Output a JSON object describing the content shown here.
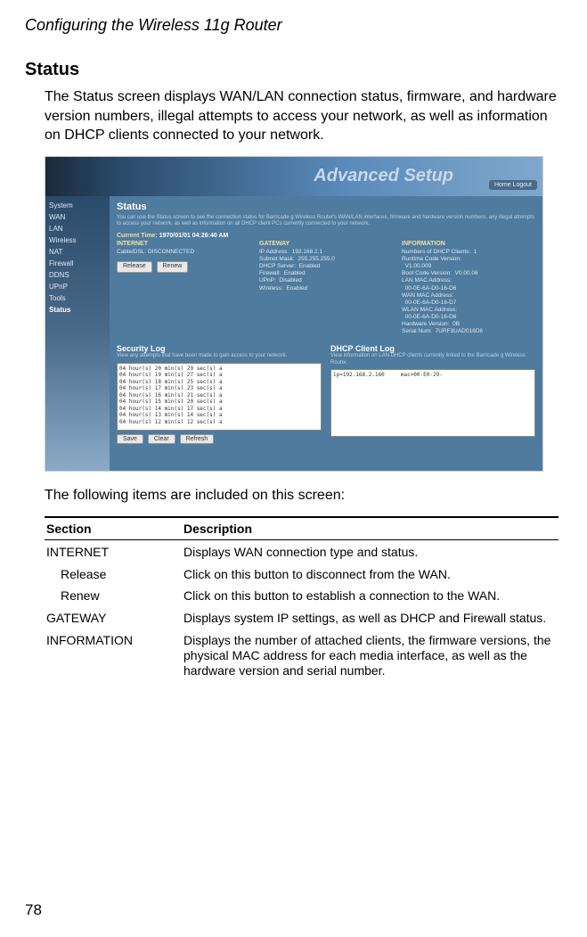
{
  "header": "Configuring the Wireless 11g Router",
  "section_title": "Status",
  "intro_para": "The Status screen displays WAN/LAN connection status, firmware, and hardware version numbers, illegal attempts to access your network, as well as information on DHCP clients connected to your network.",
  "following_text": "The following items are included on this screen:",
  "table": {
    "headers": [
      "Section",
      "Description"
    ],
    "rows": [
      {
        "section": "INTERNET",
        "indent": false,
        "desc": "Displays WAN connection type and status."
      },
      {
        "section": "Release",
        "indent": true,
        "desc": "Click on this button to disconnect from the WAN."
      },
      {
        "section": "Renew",
        "indent": true,
        "desc": "Click on this button to establish a connection to the WAN."
      },
      {
        "section": "GATEWAY",
        "indent": false,
        "desc": "Displays system IP settings, as well as DHCP and Firewall status."
      },
      {
        "section": "INFORMATION",
        "indent": false,
        "desc": "Displays the number of attached clients, the firmware versions, the physical MAC address for each media interface, as well as the hardware version and serial number."
      }
    ]
  },
  "page_number": "78",
  "screenshot": {
    "banner": "Advanced Setup",
    "home_logout": "Home  Logout",
    "sidebar": [
      "System",
      "WAN",
      "LAN",
      "Wireless",
      "NAT",
      "Firewall",
      "DDNS",
      "UPnP",
      "Tools",
      "Status"
    ],
    "title": "Status",
    "desc": "You can use the Status screen to see the connection status for Barricade g Wireless Router's WAN/LAN interfaces, firmware and hardware version numbers, any illegal attempts to access your network, as well as information on all DHCP client PCs currently connected to your network.",
    "current_time_label": "Current Time:",
    "current_time": "1970/01/01 04:26:40 AM",
    "internet": {
      "head": "INTERNET",
      "line": "Cable/DSL:  DISCONNECTED",
      "btn_release": "Release",
      "btn_renew": "Renew"
    },
    "gateway": {
      "head": "GATEWAY",
      "lines": "IP Address:  192.168.2.1\nSubnet Mask:  255.255.255.0\nDHCP Server:  Enabled\nFirewall:  Enabled\nUPnP:  Disabled\nWireless:  Enabled"
    },
    "information": {
      "head": "INFORMATION",
      "lines": "Numbers of DHCP Clients:  1\nRuntime Code Version:\n  V1.00.009\nBoot Code Version:  V0.00.06\nLAN MAC Address:\n  00-0E-6A-D0-16-D6\nWAN MAC Address:\n  00-0E-6A-D0-16-D7\nWLAN MAC Address:\n  00-0E-6A-D0-16-D6\nHardware Version:  0B\nSerial Num:  7URF3UAD016D6"
    },
    "seclog": {
      "head": "Security Log",
      "sub": "View any attempts that have been made to gain access to your network.",
      "content": "04 hour(s) 20 min(s) 29 sec(s) a\n04 hour(s) 19 min(s) 27 sec(s) a\n04 hour(s) 18 min(s) 25 sec(s) a\n04 hour(s) 17 min(s) 23 sec(s) a\n04 hour(s) 16 min(s) 21 sec(s) a\n04 hour(s) 15 min(s) 20 sec(s) a\n04 hour(s) 14 min(s) 17 sec(s) a\n04 hour(s) 13 min(s) 14 sec(s) a\n04 hour(s) 12 min(s) 12 sec(s) a",
      "btn_save": "Save",
      "btn_clear": "Clear",
      "btn_refresh": "Refresh"
    },
    "dhcplog": {
      "head": "DHCP Client Log",
      "sub": "View information on LAN DHCP clients currently linked to the Barricade g Wireless Router.",
      "content": "ip=192.168.2.160     mac=00-E0-29-"
    }
  }
}
